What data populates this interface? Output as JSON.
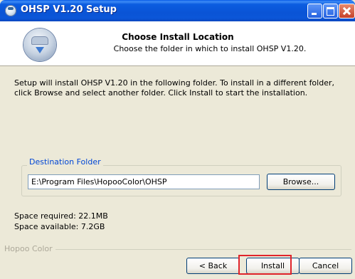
{
  "window": {
    "title": "OHSP V1.20 Setup"
  },
  "header": {
    "title": "Choose Install Location",
    "subtitle": "Choose the folder in which to install OHSP V1.20."
  },
  "body": {
    "description": "Setup will install OHSP V1.20 in the following folder. To install in a different folder, click Browse and select another folder. Click Install to start the installation.",
    "destination_group_label": "Destination Folder",
    "destination_path": "E:\\Program Files\\HopooColor\\OHSP",
    "browse_label": "Browse...",
    "space_required": "Space required: 22.1MB",
    "space_available": "Space available: 7.2GB"
  },
  "footer": {
    "brand": "Hopoo Color",
    "back_label": "< Back",
    "install_label": "Install",
    "cancel_label": "Cancel"
  },
  "colors": {
    "titlebar": "#0a54d6",
    "dialog_bg": "#ece9d8",
    "group_label": "#0046d5",
    "highlight": "#e0242b"
  },
  "icons": [
    "app-icon",
    "minimize-icon",
    "maximize-icon",
    "close-icon",
    "installer-logo-icon"
  ]
}
